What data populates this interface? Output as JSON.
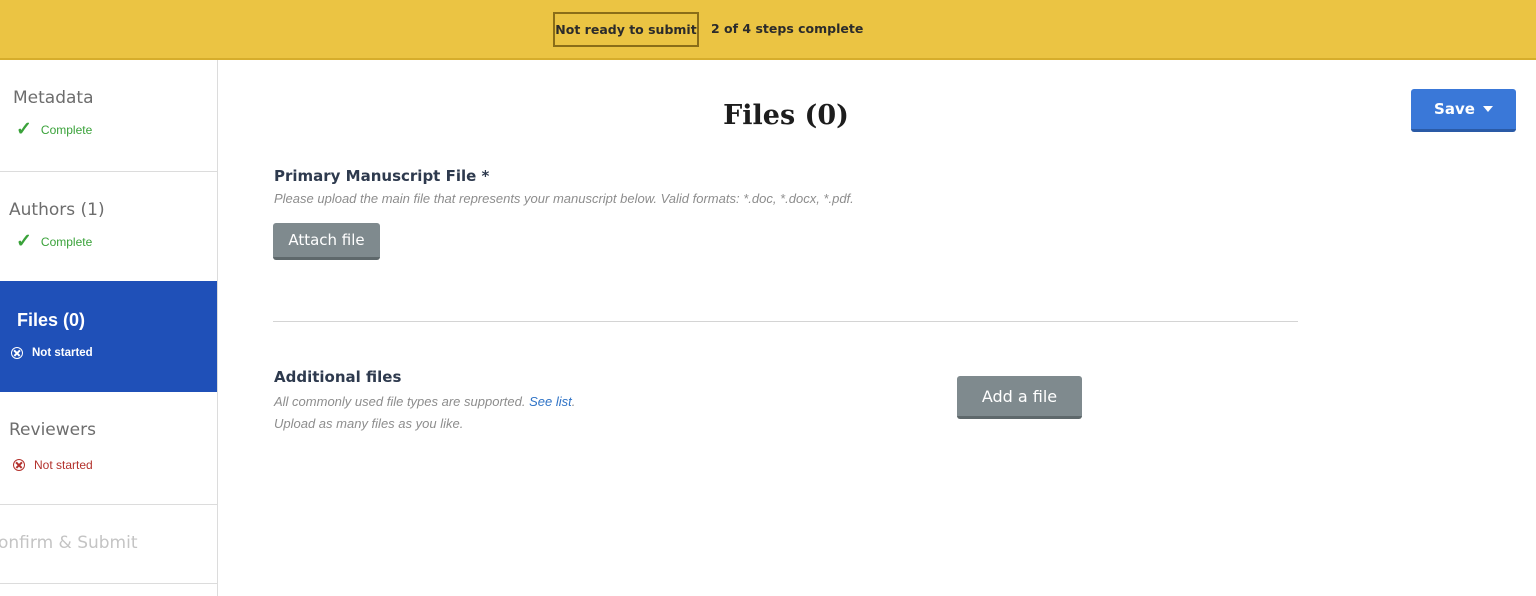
{
  "topbar": {
    "status": "Not ready to submit",
    "steps": "2 of 4  steps complete"
  },
  "sidebar": {
    "items": [
      {
        "label": "Metadata",
        "status": "Complete",
        "state": "complete"
      },
      {
        "label": "Authors (1)",
        "status": "Complete",
        "state": "complete"
      },
      {
        "label": "Files (0)",
        "status": "Not started",
        "state": "active"
      },
      {
        "label": "Reviewers",
        "status": "Not started",
        "state": "not-started"
      },
      {
        "label": "onfirm & Submit",
        "status": "",
        "state": "disabled"
      }
    ]
  },
  "main": {
    "title": "Files (0)",
    "save_label": "Save",
    "primary": {
      "heading": "Primary Manuscript File *",
      "hint": "Please upload the main file that represents your manuscript below. Valid formats: *.doc, *.docx, *.pdf.",
      "button": "Attach file"
    },
    "additional": {
      "heading": "Additional files",
      "hint_text": "All commonly used file types are supported.",
      "hint_link": "See list",
      "hint_period": ".",
      "hint2": "Upload as many files as you like.",
      "button": "Add a file"
    }
  },
  "colors": {
    "topbar": "#ebc443",
    "active": "#1f50b8",
    "save": "#3a78d8",
    "complete": "#3aa23a",
    "not_started": "#b3312c"
  }
}
